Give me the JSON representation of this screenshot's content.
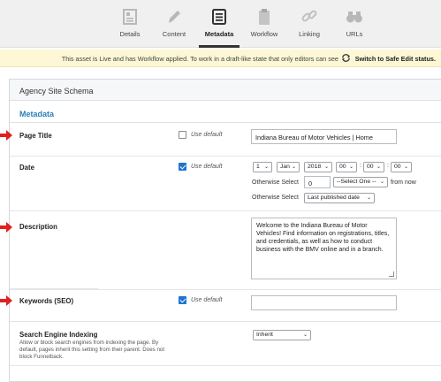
{
  "tabs": [
    {
      "label": "Details",
      "icon": "details-icon"
    },
    {
      "label": "Content",
      "icon": "pencil-icon"
    },
    {
      "label": "Metadata",
      "icon": "metadata-icon"
    },
    {
      "label": "Workflow",
      "icon": "clipboard-icon"
    },
    {
      "label": "Linking",
      "icon": "link-icon"
    },
    {
      "label": "URLs",
      "icon": "binoculars-icon"
    }
  ],
  "active_tab": "Metadata",
  "notice": {
    "message": "This asset is Live and has Workflow applied. To work in a draft-like state that only editors can see",
    "action": "Switch to Safe Edit status."
  },
  "panel": {
    "title": "Agency Site Schema",
    "section": "Metadata"
  },
  "fields": {
    "page_title": {
      "label": "Page Title",
      "use_default_label": "Use default",
      "use_default_checked": false,
      "value": "Indiana Bureau of Motor Vehicles | Home"
    },
    "date": {
      "label": "Date",
      "use_default_label": "Use default",
      "use_default_checked": true,
      "day": "1",
      "month": "Jan",
      "year": "2018",
      "hour": "00",
      "minute": "00",
      "second": "00",
      "otherwise_label_1": "Otherwise Select",
      "offset_value": "0",
      "offset_unit": "--Select One --",
      "from_now": "from now",
      "otherwise_label_2": "Otherwise Select",
      "last_published": "Last published date"
    },
    "description": {
      "label": "Description",
      "value": "Welcome to the Indiana Bureau of Motor Vehicles! Find information on registrations, titles, and credentials, as well as how to conduct business with the BMV online and in a branch."
    },
    "keywords": {
      "label": "Keywords (SEO)",
      "use_default_label": "Use default",
      "use_default_checked": true,
      "value": ""
    },
    "search_indexing": {
      "label": "Search Engine Indexing",
      "help": "Allow or block search engines from indexing the page. By default, pages inherit this setting from their parent. Does not block Funnelback.",
      "value": "Inherit"
    }
  },
  "colors": {
    "accent": "#2a7fb8",
    "arrow": "#e02020",
    "notice_bg": "#fdf7d6",
    "checkbox": "#1f74d1"
  }
}
